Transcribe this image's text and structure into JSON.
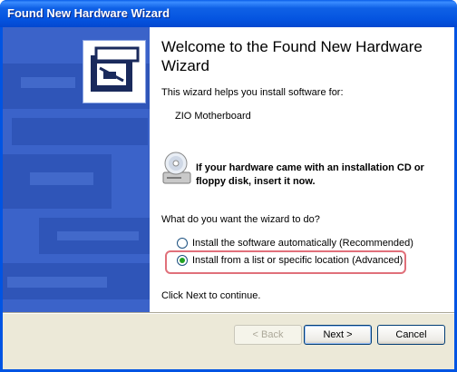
{
  "window": {
    "title": "Found New Hardware Wizard"
  },
  "main": {
    "heading": "Welcome to the Found New Hardware Wizard",
    "intro": "This wizard helps you install software for:",
    "device_name": "ZIO Motherboard",
    "cd_instruction": "If your hardware came with an installation CD or floppy disk, insert it now.",
    "question": "What do you want the wizard to do?",
    "options": [
      {
        "label": "Install the software automatically (Recommended)",
        "selected": false
      },
      {
        "label": "Install from a list or specific location (Advanced)",
        "selected": true
      }
    ],
    "footer_note": "Click Next to continue."
  },
  "buttons": {
    "back": "< Back",
    "next": "Next >",
    "cancel": "Cancel"
  },
  "colors": {
    "titlebar": "#0054e3",
    "sidebar": "#3b63c9",
    "highlight": "#e0707a",
    "button_bar": "#ece9d8"
  },
  "icons": {
    "wizard": "hardware-drawer-icon",
    "cd": "cd-drive-icon"
  }
}
